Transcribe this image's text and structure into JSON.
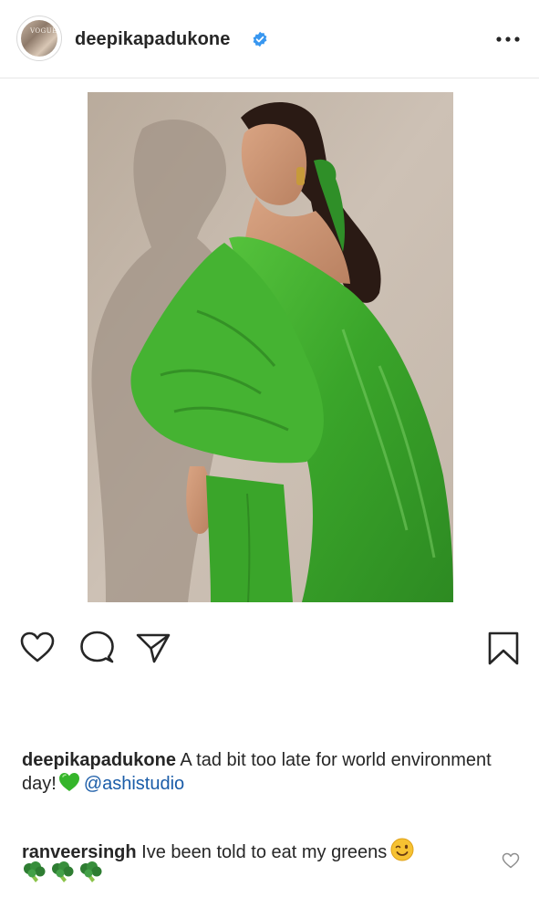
{
  "post": {
    "username": "deepikapadukone",
    "avatar_text": "VOGUE",
    "verified": true
  },
  "icons": {
    "verified": "verified-badge-icon",
    "more": "more-options-icon",
    "like": "heart-icon",
    "comment": "comment-icon",
    "share": "share-icon",
    "save": "bookmark-icon"
  },
  "caption": {
    "username": "deepikapadukone",
    "text": "A tad bit too late for world environment day!",
    "emoji": "green-heart-emoji",
    "mention": "@ashistudio"
  },
  "comments": [
    {
      "username": "ranveersingh",
      "text": "Ive been told to eat my greens",
      "emojis": [
        "winking-face-emoji",
        "broccoli-emoji",
        "broccoli-emoji",
        "broccoli-emoji"
      ]
    }
  ],
  "colors": {
    "text": "#262626",
    "mention": "#1a5ca8",
    "verified": "#3897f0",
    "dress": "#3fae2e",
    "background_wall": "#c8bcb0",
    "divider": "#e6e6e6"
  }
}
